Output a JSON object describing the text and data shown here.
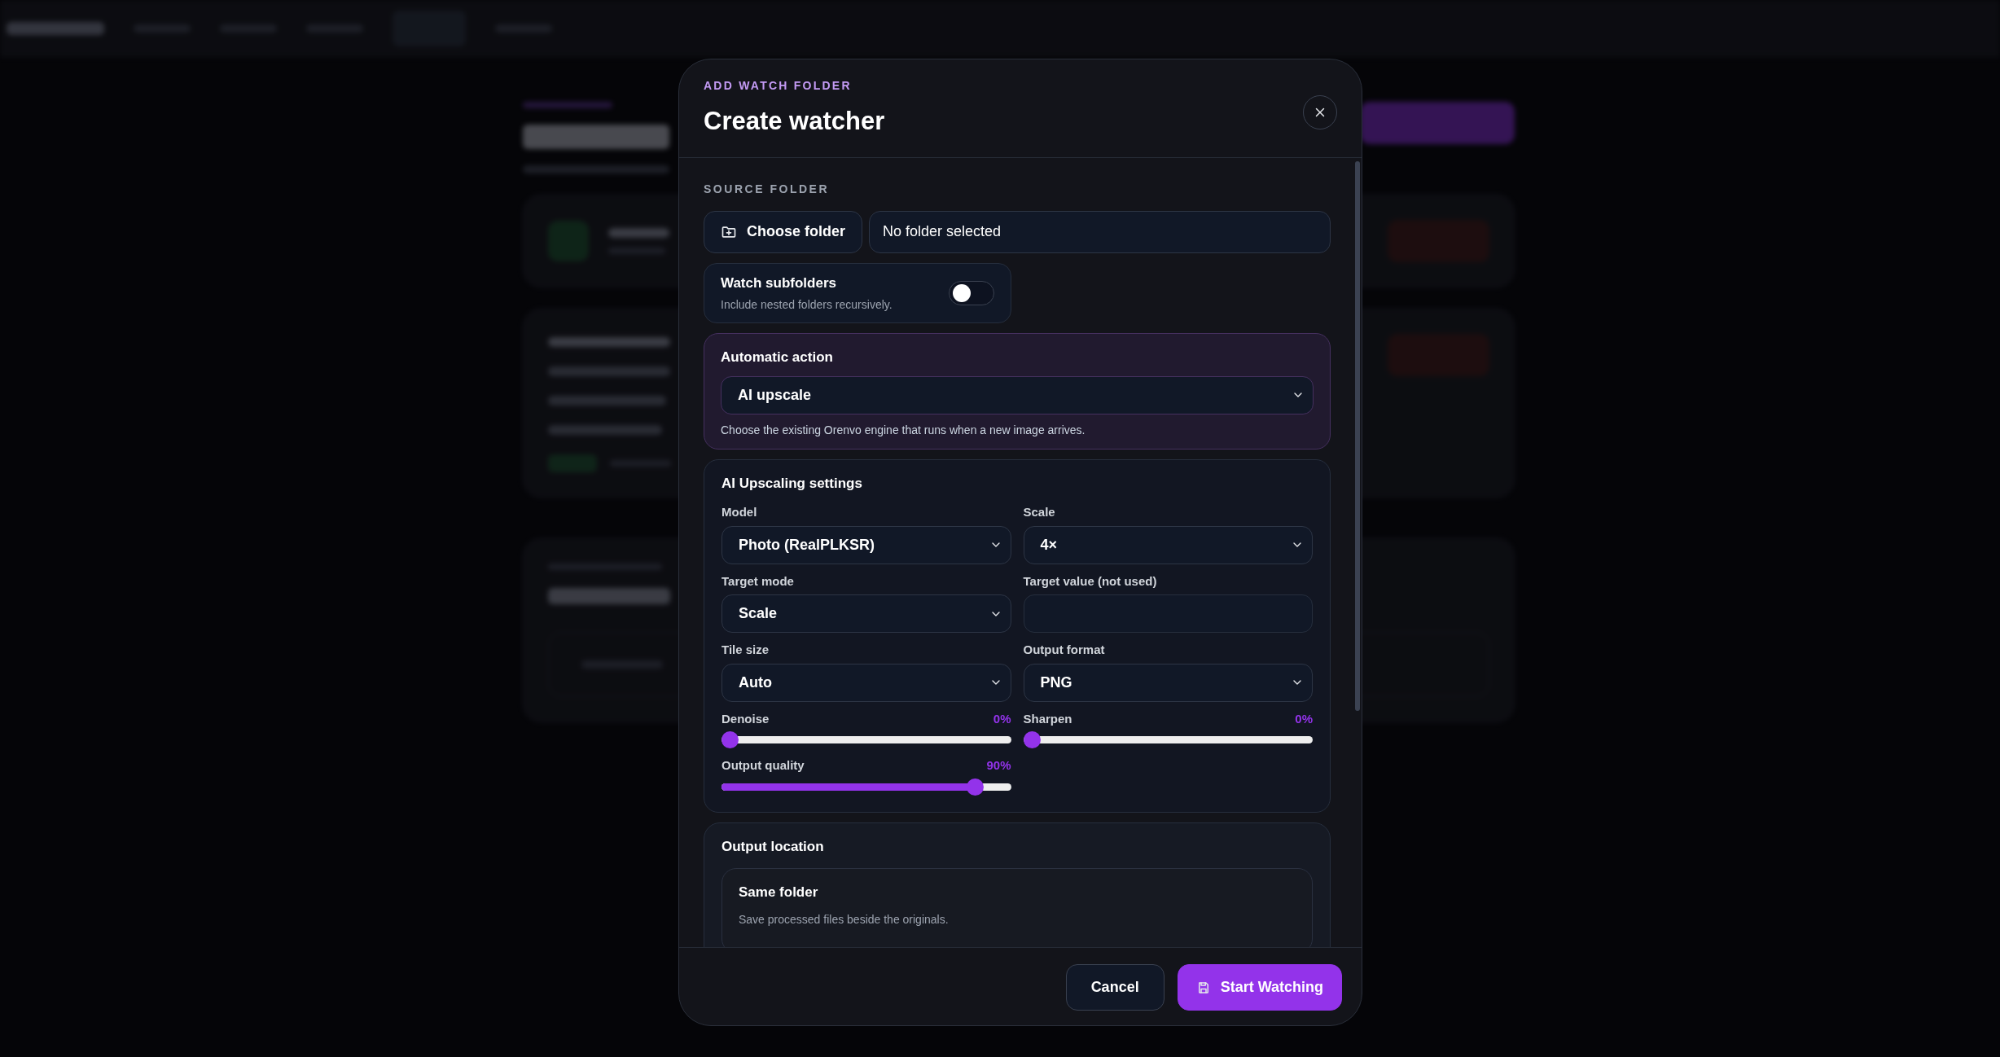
{
  "dialog": {
    "eyebrow": "ADD WATCH FOLDER",
    "title": "Create watcher",
    "source": {
      "heading": "SOURCE FOLDER",
      "choose_button": "Choose folder",
      "path": "No folder selected"
    },
    "subfolders": {
      "label": "Watch subfolders",
      "hint": "Include nested folders recursively.",
      "on": false
    },
    "action": {
      "heading": "Automatic action",
      "value": "AI upscale",
      "hint": "Choose the existing Orenvo engine that runs when a new image arrives."
    },
    "settings": {
      "heading": "AI Upscaling settings",
      "fields": [
        {
          "kind": "select",
          "label": "Model",
          "value": "Photo (RealPLKSR)"
        },
        {
          "kind": "select",
          "label": "Scale",
          "value": "4×"
        },
        {
          "kind": "select",
          "label": "Target mode",
          "value": "Scale"
        },
        {
          "kind": "input",
          "label": "Target value (not used)"
        },
        {
          "kind": "select",
          "label": "Tile size",
          "value": "Auto"
        },
        {
          "kind": "select",
          "label": "Output format",
          "value": "PNG"
        },
        {
          "kind": "slider",
          "label": "Denoise",
          "reading": "0%",
          "level": 0
        },
        {
          "kind": "slider",
          "label": "Sharpen",
          "reading": "0%",
          "level": 0
        },
        {
          "kind": "slider",
          "label": "Output quality",
          "reading": "90%",
          "level": 0.9
        }
      ]
    },
    "output": {
      "heading": "Output location",
      "options": [
        {
          "title": "Same folder",
          "description": "Save processed files beside the originals."
        }
      ]
    },
    "buttons": [
      {
        "label": "Cancel",
        "kind": "secondary"
      },
      {
        "label": "Start Watching",
        "kind": "primary"
      }
    ]
  }
}
